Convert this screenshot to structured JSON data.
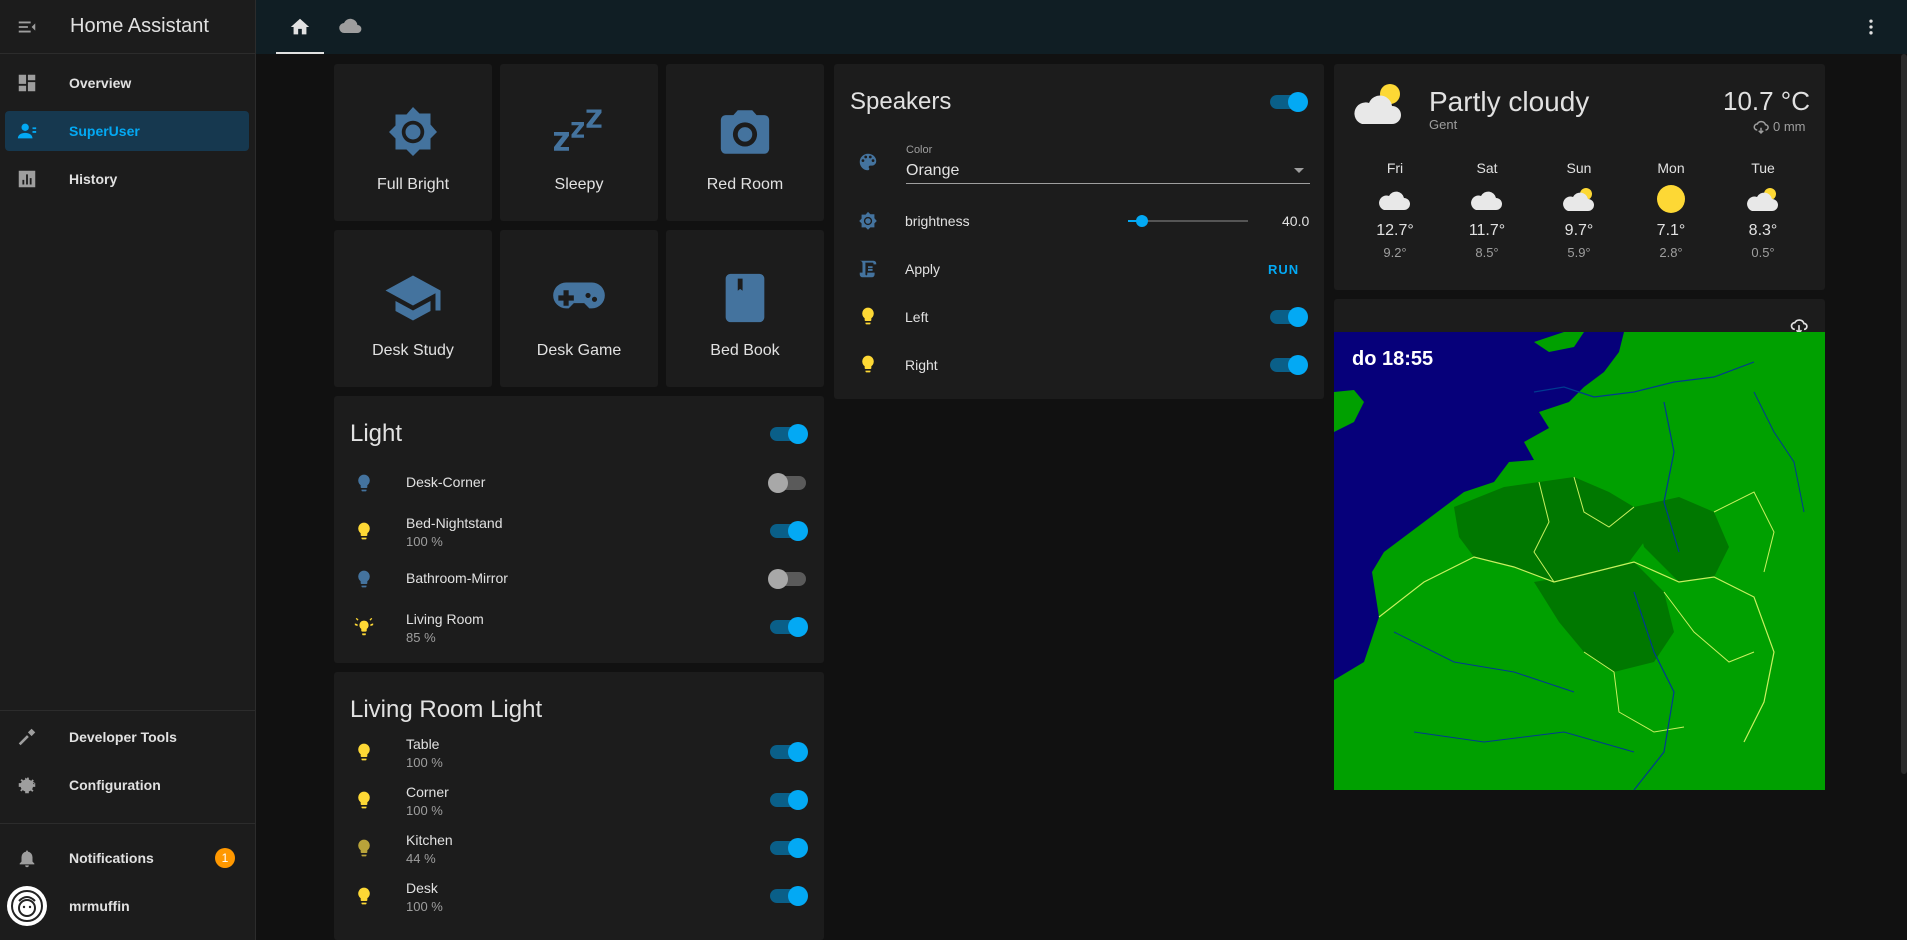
{
  "app": {
    "title": "Home Assistant"
  },
  "sidebar": {
    "items": [
      {
        "label": "Overview",
        "icon": "dashboard-icon"
      },
      {
        "label": "SuperUser",
        "icon": "account-icon",
        "active": true
      },
      {
        "label": "History",
        "icon": "chart-box-icon"
      }
    ],
    "bottom_items": [
      {
        "label": "Developer Tools",
        "icon": "hammer-icon"
      },
      {
        "label": "Configuration",
        "icon": "cog-icon"
      },
      {
        "label": "Notifications",
        "icon": "bell-icon",
        "badge": "1"
      },
      {
        "label": "mrmuffin",
        "icon": "avatar-icon"
      }
    ]
  },
  "topbar": {
    "tabs": [
      {
        "icon": "home-icon",
        "active": true
      },
      {
        "icon": "cloud-icon",
        "active": false
      }
    ]
  },
  "scenes": [
    {
      "label": "Full Bright",
      "icon": "brightness-icon"
    },
    {
      "label": "Sleepy",
      "icon": "sleep-icon"
    },
    {
      "label": "Red Room",
      "icon": "camera-icon"
    },
    {
      "label": "Desk Study",
      "icon": "school-icon"
    },
    {
      "label": "Desk Game",
      "icon": "gamepad-icon"
    },
    {
      "label": "Bed Book",
      "icon": "bookmark-book-icon"
    }
  ],
  "light_card": {
    "title": "Light",
    "header_on": true,
    "rows": [
      {
        "name": "Desk-Corner",
        "sub": "",
        "on": false,
        "icon": "bulb-icon"
      },
      {
        "name": "Bed-Nightstand",
        "sub": "100 %",
        "on": true,
        "icon": "bulb-icon"
      },
      {
        "name": "Bathroom-Mirror",
        "sub": "",
        "on": false,
        "icon": "bulb-icon"
      },
      {
        "name": "Living Room",
        "sub": "85 %",
        "on": true,
        "icon": "bulb-group-icon"
      }
    ]
  },
  "living_room_card": {
    "title": "Living Room Light",
    "rows": [
      {
        "name": "Table",
        "sub": "100 %",
        "on": true
      },
      {
        "name": "Corner",
        "sub": "100 %",
        "on": true
      },
      {
        "name": "Kitchen",
        "sub": "44 %",
        "on": true
      },
      {
        "name": "Desk",
        "sub": "100 %",
        "on": true
      }
    ]
  },
  "speakers_card": {
    "title": "Speakers",
    "header_on": true,
    "color_label": "Color",
    "color_value": "Orange",
    "brightness_label": "brightness",
    "brightness_value": "40.0",
    "brightness_fraction": 0.12,
    "apply_label": "Apply",
    "run_label": "RUN",
    "left_label": "Left",
    "right_label": "Right",
    "left_on": true,
    "right_on": true
  },
  "weather": {
    "condition": "Partly cloudy",
    "location": "Gent",
    "temperature": "10.7 °C",
    "precipitation": "0 mm",
    "forecast": [
      {
        "day": "Fri",
        "hi": "12.7°",
        "lo": "9.2°",
        "icon": "cloudy-icon"
      },
      {
        "day": "Sat",
        "hi": "11.7°",
        "lo": "8.5°",
        "icon": "cloudy-icon"
      },
      {
        "day": "Sun",
        "hi": "9.7°",
        "lo": "5.9°",
        "icon": "partly-cloudy-icon"
      },
      {
        "day": "Mon",
        "hi": "7.1°",
        "lo": "2.8°",
        "icon": "sunny-icon"
      },
      {
        "day": "Tue",
        "hi": "8.3°",
        "lo": "0.5°",
        "icon": "partly-cloudy-icon"
      }
    ]
  },
  "radar": {
    "timestamp": "do 18:55"
  },
  "colors": {
    "accent": "#03a9f4",
    "bulb_on": "#fdd835",
    "bulb_off": "#44739e",
    "badge": "#ff9800",
    "scene_icon": "#44739e"
  }
}
